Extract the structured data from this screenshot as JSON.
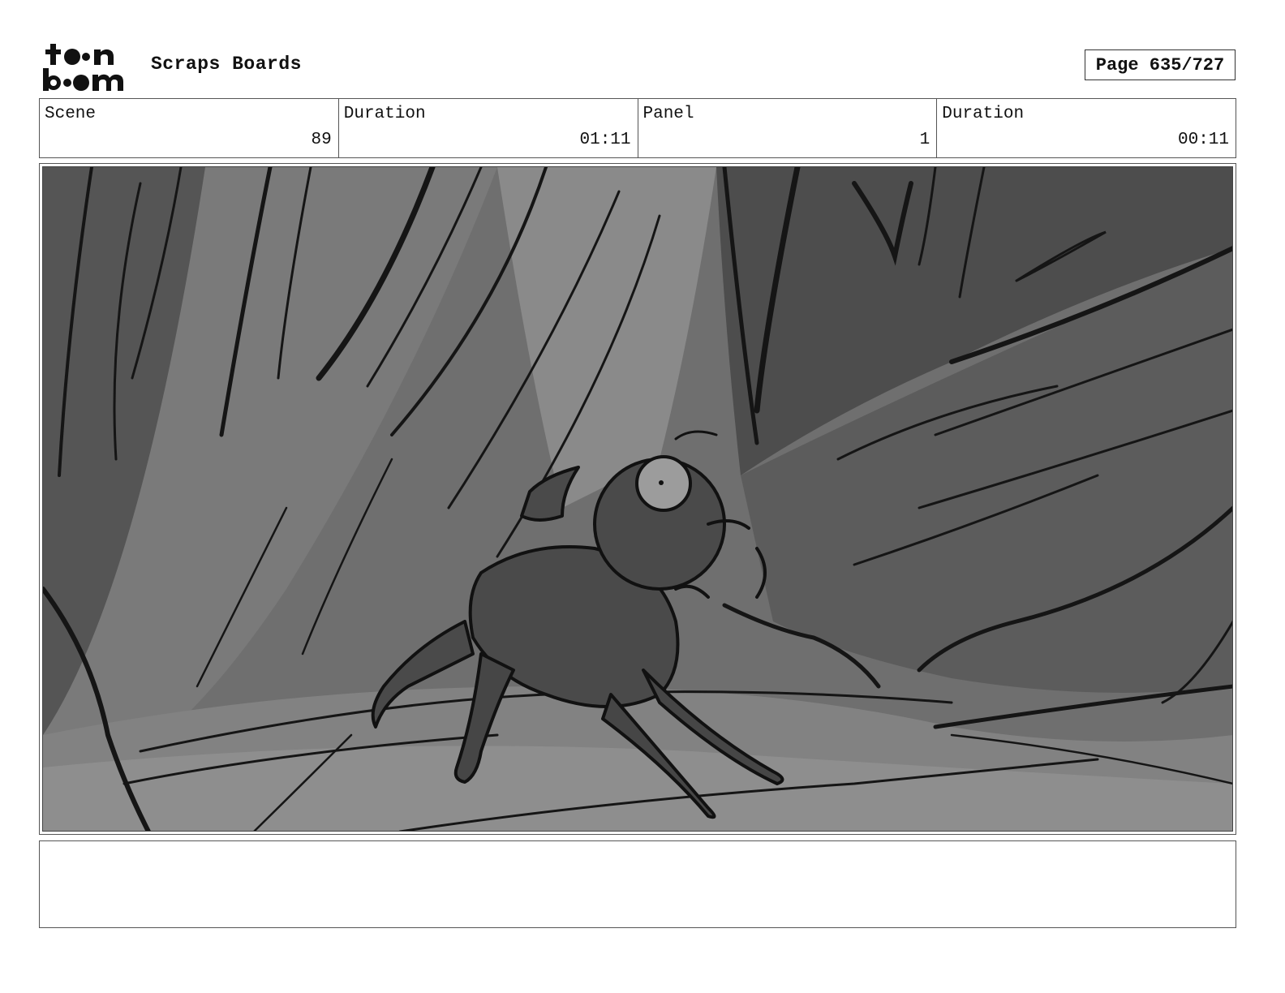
{
  "header": {
    "logo_alt": "toon boom",
    "title": "Scraps Boards",
    "page_label": "Page 635/727"
  },
  "info": {
    "scene_label": "Scene",
    "scene_value": "89",
    "scene_duration_label": "Duration",
    "scene_duration_value": "01:11",
    "panel_label": "Panel",
    "panel_value": "1",
    "panel_duration_label": "Duration",
    "panel_duration_value": "00:11"
  },
  "notes": {
    "text": ""
  }
}
